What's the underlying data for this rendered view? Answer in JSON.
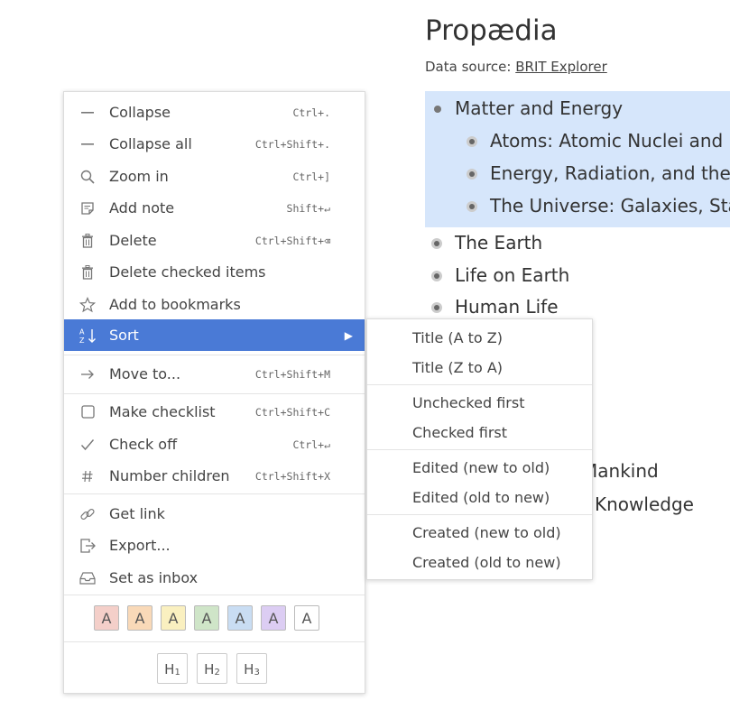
{
  "document": {
    "title": "Propædia",
    "source_label": "Data source:",
    "source_link": "BRIT Explorer",
    "nodes": [
      {
        "label": "Matter and Energy"
      },
      {
        "label": "Atoms: Atomic Nuclei and El"
      },
      {
        "label": "Energy, Radiation, and the Sta"
      },
      {
        "label": "The Universe: Galaxies, Stars"
      },
      {
        "label": "The Earth"
      },
      {
        "label": "Life on Earth"
      },
      {
        "label": "Human Life"
      },
      {
        "label": "Mankind"
      },
      {
        "label": "Knowledge"
      }
    ]
  },
  "context_menu": {
    "items": [
      {
        "label": "Collapse",
        "shortcut": "Ctrl+.",
        "icon": "minus-icon"
      },
      {
        "label": "Collapse all",
        "shortcut": "Ctrl+Shift+.",
        "icon": "minus-icon"
      },
      {
        "label": "Zoom in",
        "shortcut": "Ctrl+]",
        "icon": "search-icon"
      },
      {
        "label": "Add note",
        "shortcut": "Shift+↵",
        "icon": "note-icon"
      },
      {
        "label": "Delete",
        "shortcut": "Ctrl+Shift+⌫",
        "icon": "trash-icon"
      },
      {
        "label": "Delete checked items",
        "shortcut": "",
        "icon": "trash-icon"
      },
      {
        "label": "Add to bookmarks",
        "shortcut": "",
        "icon": "star-icon"
      },
      {
        "label": "Sort",
        "shortcut": "",
        "icon": "sort-az-icon"
      },
      {
        "label": "Move to...",
        "shortcut": "Ctrl+Shift+M",
        "icon": "arrow-right-icon"
      },
      {
        "label": "Make checklist",
        "shortcut": "Ctrl+Shift+C",
        "icon": "checkbox-icon"
      },
      {
        "label": "Check off",
        "shortcut": "Ctrl+↵",
        "icon": "check-icon"
      },
      {
        "label": "Number children",
        "shortcut": "Ctrl+Shift+X",
        "icon": "hash-icon"
      },
      {
        "label": "Get link",
        "shortcut": "",
        "icon": "link-icon"
      },
      {
        "label": "Export...",
        "shortcut": "",
        "icon": "export-icon"
      },
      {
        "label": "Set as inbox",
        "shortcut": "",
        "icon": "inbox-icon"
      }
    ],
    "color_swatches": [
      {
        "label": "A",
        "color": "#f4cfc9"
      },
      {
        "label": "A",
        "color": "#f9d9b8"
      },
      {
        "label": "A",
        "color": "#faf0c0"
      },
      {
        "label": "A",
        "color": "#cfe5c8"
      },
      {
        "label": "A",
        "color": "#c9ddf3"
      },
      {
        "label": "A",
        "color": "#dccdf3"
      },
      {
        "label": "A",
        "color": "#ffffff"
      }
    ],
    "headings": [
      {
        "letter": "H",
        "level": "1"
      },
      {
        "letter": "H",
        "level": "2"
      },
      {
        "letter": "H",
        "level": "3"
      }
    ],
    "accent_color": "#4a7ad6"
  },
  "sort_submenu": {
    "items": [
      {
        "label": "Title (A to Z)"
      },
      {
        "label": "Title (Z to A)"
      },
      {
        "label": "Unchecked first"
      },
      {
        "label": "Checked first"
      },
      {
        "label": "Edited (new to old)"
      },
      {
        "label": "Edited (old to new)"
      },
      {
        "label": "Created (new to old)"
      },
      {
        "label": "Created (old to new)"
      }
    ]
  }
}
